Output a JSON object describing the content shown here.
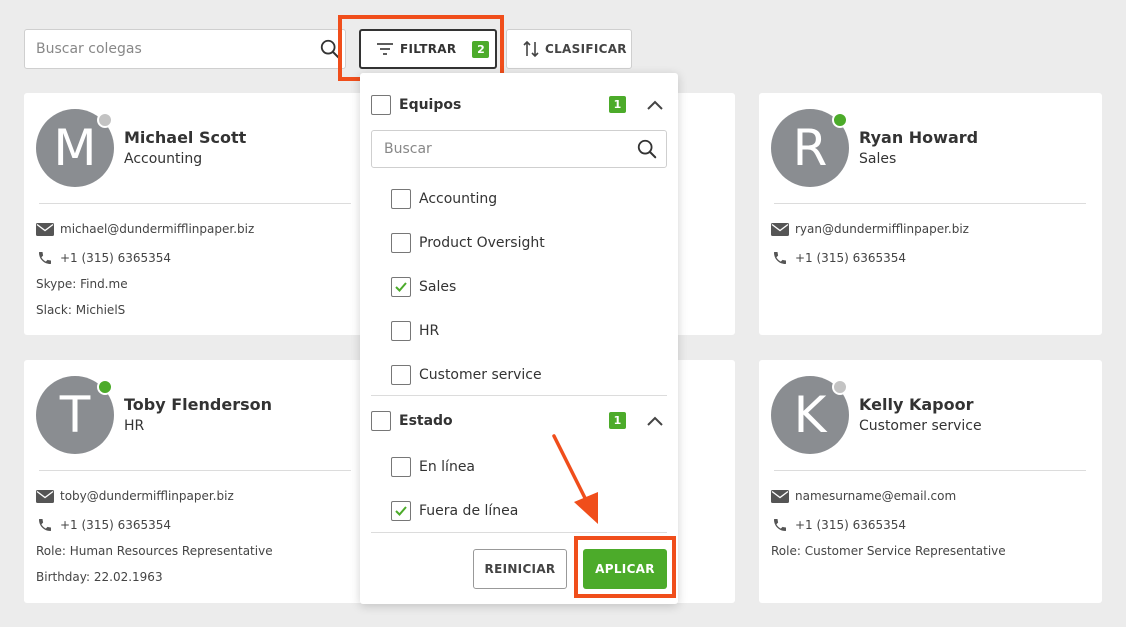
{
  "toolbar": {
    "search_placeholder": "Buscar colegas",
    "filter_label": "FILTRAR",
    "filter_count": "2",
    "sort_label": "CLASIFICAR"
  },
  "colors": {
    "accent": "#4cab2a",
    "highlight": "#f04e1b",
    "avatar": "#8a8d91"
  },
  "cards": [
    {
      "initial": "M",
      "name": "Michael Scott",
      "team": "Accounting",
      "status": "offline",
      "email": "michael@dundermifflinpaper.biz",
      "phone": "+1 (315) 6365354",
      "extra": [
        "Skype: Find.me",
        "Slack: MichielS"
      ]
    },
    {
      "initial": "R",
      "name": "Ryan Howard",
      "team": "Sales",
      "status": "online",
      "email": "ryan@dundermifflinpaper.biz",
      "phone": "+1 (315) 6365354",
      "extra": []
    },
    {
      "initial": "T",
      "name": "Toby Flenderson",
      "team": "HR",
      "status": "online",
      "email": "toby@dundermifflinpaper.biz",
      "phone": "+1 (315) 6365354",
      "extra": [
        "Role: Human Resources Representative",
        "Birthday: 22.02.1963"
      ]
    },
    {
      "initial": "K",
      "name": "Kelly Kapoor",
      "team": "Customer service",
      "status": "offline",
      "email": "namesurname@email.com",
      "phone": "+1 (315) 6365354",
      "extra": [
        "Role: Customer Service Representative"
      ]
    }
  ],
  "filter_panel": {
    "teams": {
      "title": "Equipos",
      "count": "1",
      "search_placeholder": "Buscar",
      "options": [
        {
          "label": "Accounting",
          "checked": false
        },
        {
          "label": "Product Oversight",
          "checked": false
        },
        {
          "label": "Sales",
          "checked": true
        },
        {
          "label": "HR",
          "checked": false
        },
        {
          "label": "Customer service",
          "checked": false
        }
      ]
    },
    "status": {
      "title": "Estado",
      "count": "1",
      "options": [
        {
          "label": "En línea",
          "checked": false
        },
        {
          "label": "Fuera de línea",
          "checked": true
        }
      ]
    },
    "reset_label": "REINICIAR",
    "apply_label": "APLICAR"
  }
}
